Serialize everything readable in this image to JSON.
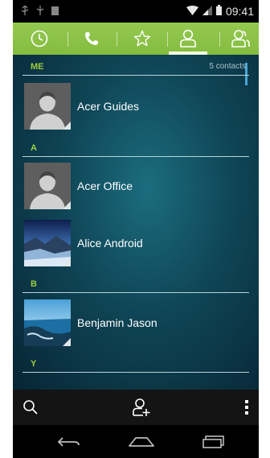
{
  "status_bar": {
    "time": "09:41",
    "left_icons": [
      "usb-icon",
      "debug-icon",
      "notification-icon"
    ],
    "right_icons": [
      "wifi-icon",
      "signal-icon",
      "battery-icon"
    ]
  },
  "tabs": [
    {
      "name": "recent",
      "icon": "clock-icon"
    },
    {
      "name": "phone",
      "icon": "phone-icon"
    },
    {
      "name": "favorites",
      "icon": "star-icon"
    },
    {
      "name": "contacts",
      "icon": "person-icon",
      "selected": true
    },
    {
      "name": "groups",
      "icon": "group-icon"
    }
  ],
  "accent_color": "#8bc34a",
  "sections": {
    "me": {
      "letter": "ME",
      "count": "5 contacts"
    },
    "a": {
      "letter": "A"
    },
    "b": {
      "letter": "B"
    },
    "y": {
      "letter": "Y"
    }
  },
  "contacts": {
    "acer_guides": {
      "name": "Acer Guides",
      "photo": "default-avatar"
    },
    "acer_office": {
      "name": "Acer Office",
      "photo": "default-avatar"
    },
    "alice_android": {
      "name": "Alice Android",
      "photo": "landscape-photo"
    },
    "benjamin_jason": {
      "name": "Benjamin Jason",
      "photo": "beach-photo"
    }
  },
  "action_bar": [
    "search-icon",
    "add-contact-icon",
    "overflow-menu-icon"
  ],
  "nav_bar": [
    "back-icon",
    "home-icon",
    "recents-icon"
  ]
}
